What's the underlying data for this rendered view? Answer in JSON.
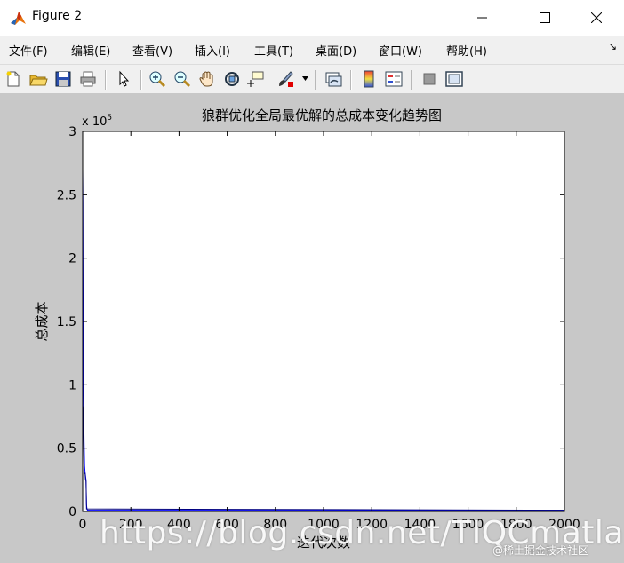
{
  "window": {
    "title": "Figure 2"
  },
  "menu": {
    "items": [
      "文件(F)",
      "编辑(E)",
      "查看(V)",
      "插入(I)",
      "工具(T)",
      "桌面(D)",
      "窗口(W)",
      "帮助(H)"
    ],
    "overflow_icon": "arrow-icon"
  },
  "toolbar": {
    "buttons": [
      "new-figure-icon",
      "open-icon",
      "save-icon",
      "print-icon",
      "edit-plot-icon",
      "zoom-in-icon",
      "zoom-out-icon",
      "pan-icon",
      "rotate-3d-icon",
      "data-cursor-icon",
      "brush-icon",
      "link-plot-icon",
      "colorbar-icon",
      "legend-icon",
      "hide-plot-tools-icon",
      "show-plot-tools-icon"
    ]
  },
  "chart_data": {
    "type": "line",
    "title": "狼群优化全局最优解的总成本变化趋势图",
    "xlabel": "迭代次数",
    "ylabel": "总成本",
    "y_multiplier": "x 10",
    "y_multiplier_exp": "5",
    "xlim": [
      0,
      2000
    ],
    "ylim": [
      0,
      3
    ],
    "xticks": [
      "0",
      "200",
      "400",
      "600",
      "800",
      "1000",
      "1200",
      "1400",
      "1600",
      "1800",
      "2000"
    ],
    "yticks": [
      "0",
      "0.5",
      "1",
      "1.5",
      "2",
      "2.5",
      "3"
    ],
    "grid": false,
    "series": [
      {
        "color": "#0000ff",
        "x": [
          0,
          1,
          2,
          4,
          6,
          8,
          10,
          12,
          14,
          16,
          18,
          20,
          2000
        ],
        "y": [
          2.7,
          2.45,
          1.55,
          0.82,
          0.55,
          0.36,
          0.31,
          0.28,
          0.25,
          0.05,
          0.02,
          0.01,
          0.01
        ]
      },
      {
        "color": "#000080",
        "x": [
          1,
          2,
          4,
          6,
          8,
          10,
          12,
          14,
          16,
          2000
        ],
        "y": [
          0.83,
          0.82,
          0.55,
          0.31,
          0.3,
          0.3,
          0.25,
          0.24,
          0.02,
          0.01
        ]
      }
    ]
  },
  "watermarks": {
    "main": "https://blog.csdn.net/TIQCmatlab",
    "secondary": "@稀土掘金技术社区"
  }
}
